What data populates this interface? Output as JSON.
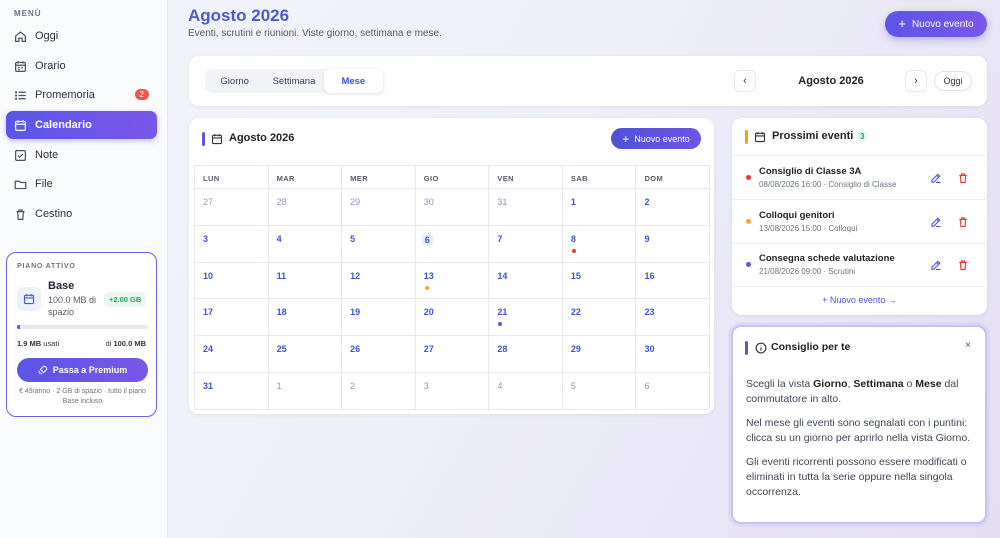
{
  "sidebar": {
    "menu_title": "MENÙ",
    "items": [
      {
        "label": "Oggi",
        "icon": "home-icon"
      },
      {
        "label": "Orario",
        "icon": "calendar-grid-icon"
      },
      {
        "label": "Promemoria",
        "icon": "list-icon",
        "badge": "2"
      },
      {
        "label": "Calendario",
        "icon": "calendar-icon",
        "active": true
      },
      {
        "label": "Note",
        "icon": "note-check-icon"
      },
      {
        "label": "File",
        "icon": "folder-icon"
      },
      {
        "label": "Cestino",
        "icon": "trash-icon"
      }
    ],
    "plan": {
      "label": "PIANO ATTIVO",
      "name": "Base",
      "space": "100.0 MB di spazio",
      "bonus": "+2.00 GB",
      "used_value": "1.9 MB",
      "used_suffix": "usati",
      "total_prefix": "di",
      "total_value": "100.0 MB",
      "usage_fraction": 0.019,
      "premium_label": "Passa a Premium",
      "footnote": "€ 49/anno · 2 GB di spazio · tutto il piano Base incluso"
    }
  },
  "header": {
    "title": "Agosto 2026",
    "subtitle": "Eventi, scrutini e riunioni. Viste giorno, settimana e mese.",
    "new_event_label": "Nuovo evento"
  },
  "view_switch": {
    "tabs": [
      {
        "label": "Giorno",
        "active": false
      },
      {
        "label": "Settimana",
        "active": false
      },
      {
        "label": "Mese",
        "active": true
      }
    ],
    "month": "Agosto 2026",
    "today_label": "Oggi"
  },
  "calendar": {
    "title": "Agosto 2026",
    "new_event_label": "Nuovo evento",
    "weekdays": [
      "LUN",
      "MAR",
      "MER",
      "GIO",
      "VEN",
      "SAB",
      "DOM"
    ],
    "weeks": [
      [
        {
          "d": "27",
          "o": true
        },
        {
          "d": "28",
          "o": true
        },
        {
          "d": "29",
          "o": true
        },
        {
          "d": "30",
          "o": true
        },
        {
          "d": "31",
          "o": true
        },
        {
          "d": "1"
        },
        {
          "d": "2"
        }
      ],
      [
        {
          "d": "3"
        },
        {
          "d": "4"
        },
        {
          "d": "5"
        },
        {
          "d": "6",
          "today": true
        },
        {
          "d": "7"
        },
        {
          "d": "8",
          "dot": "#e53935"
        },
        {
          "d": "9"
        }
      ],
      [
        {
          "d": "10"
        },
        {
          "d": "11"
        },
        {
          "d": "12"
        },
        {
          "d": "13",
          "dot": "#f5a623"
        },
        {
          "d": "14"
        },
        {
          "d": "15"
        },
        {
          "d": "16"
        }
      ],
      [
        {
          "d": "17"
        },
        {
          "d": "18"
        },
        {
          "d": "19"
        },
        {
          "d": "20"
        },
        {
          "d": "21",
          "dot": "#6d4fe0"
        },
        {
          "d": "22"
        },
        {
          "d": "23"
        }
      ],
      [
        {
          "d": "24"
        },
        {
          "d": "25"
        },
        {
          "d": "26"
        },
        {
          "d": "27"
        },
        {
          "d": "28"
        },
        {
          "d": "29"
        },
        {
          "d": "30"
        }
      ],
      [
        {
          "d": "31"
        },
        {
          "d": "1",
          "o": true
        },
        {
          "d": "2",
          "o": true
        },
        {
          "d": "3",
          "o": true
        },
        {
          "d": "4",
          "o": true
        },
        {
          "d": "5",
          "o": true
        },
        {
          "d": "6",
          "o": true
        }
      ]
    ]
  },
  "upcoming": {
    "title": "Prossimi eventi",
    "count": "3",
    "events": [
      {
        "name": "Consiglio di Classe 3A",
        "meta": "08/08/2026 16:00 · Consiglio di Classe",
        "color": "#e53935"
      },
      {
        "name": "Colloqui genitori",
        "meta": "13/08/2026 15:00 · Colloqui",
        "color": "#f5a623"
      },
      {
        "name": "Consegna schede valutazione",
        "meta": "21/08/2026 09:00 · Scrutini",
        "color": "#6d4fe0"
      }
    ],
    "more_label": "+ Nuovo evento →"
  },
  "tip": {
    "title": "Consiglio per te",
    "close": "×",
    "p1_a": "Scegli la vista ",
    "p1_giorno": "Giorno",
    "p1_b": ", ",
    "p1_settimana": "Settimana",
    "p1_c": " o ",
    "p1_mese": "Mese",
    "p1_d": " dal commutatore in alto.",
    "p2": "Nel mese gli eventi sono segnalati con i puntini: clicca su un giorno per aprirlo nella vista Giorno.",
    "p3": "Gli eventi ricorrenti possono essere modificati o eliminati in tutta la serie oppure nella singola occorrenza."
  },
  "colors": {
    "accent": "#5b56e8",
    "title_blue": "#4b57d8",
    "day_blue": "#3b53d6"
  }
}
